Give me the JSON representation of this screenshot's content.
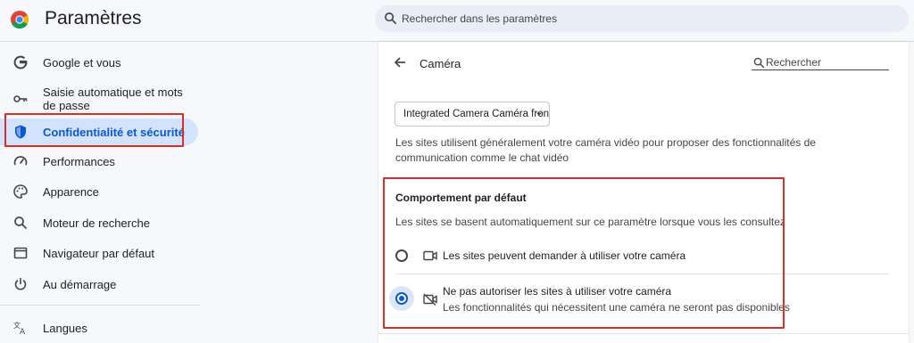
{
  "app": {
    "title": "Paramètres",
    "logo_icon": "chrome-logo-icon"
  },
  "search": {
    "placeholder": "Rechercher dans les paramètres",
    "icon": "search-icon"
  },
  "sidebar": {
    "items": [
      {
        "label": "Google et vous",
        "icon": "google-g-icon",
        "active": false
      },
      {
        "label": "Saisie automatique et mots de passe",
        "icon": "key-icon",
        "active": false
      },
      {
        "label": "Confidentialité et sécurité",
        "icon": "shield-icon",
        "active": true
      },
      {
        "label": "Performances",
        "icon": "speedometer-icon",
        "active": false
      },
      {
        "label": "Apparence",
        "icon": "palette-icon",
        "active": false
      },
      {
        "label": "Moteur de recherche",
        "icon": "search-icon",
        "active": false
      },
      {
        "label": "Navigateur par défaut",
        "icon": "browser-window-icon",
        "active": false
      },
      {
        "label": "Au démarrage",
        "icon": "power-icon",
        "active": false
      },
      {
        "label": "Langues",
        "icon": "translate-icon",
        "active": false
      }
    ]
  },
  "panel": {
    "title": "Caméra",
    "search_label": "Rechercher",
    "camera_select": {
      "value": "Integrated Camera Caméra fron"
    },
    "description": "Les sites utilisent généralement votre caméra vidéo pour proposer des fonctionnalités de communication comme le chat vidéo",
    "default_behavior": {
      "title": "Comportement par défaut",
      "subtitle": "Les sites se basent automatiquement sur ce paramètre lorsque vous les consultez",
      "options": [
        {
          "label": "Les sites peuvent demander à utiliser votre caméra",
          "sublabel": "",
          "icon": "camera-icon",
          "checked": false
        },
        {
          "label": "Ne pas autoriser les sites à utiliser votre caméra",
          "sublabel": "Les fonctionnalités qui nécessitent une caméra ne seront pas disponibles",
          "icon": "camera-off-icon",
          "checked": true
        }
      ]
    }
  },
  "colors": {
    "accent": "#0b57d0",
    "active_nav_bg": "#d3e3fd",
    "annotation_red": "#d93025",
    "page_bg": "#f6f8fc"
  }
}
